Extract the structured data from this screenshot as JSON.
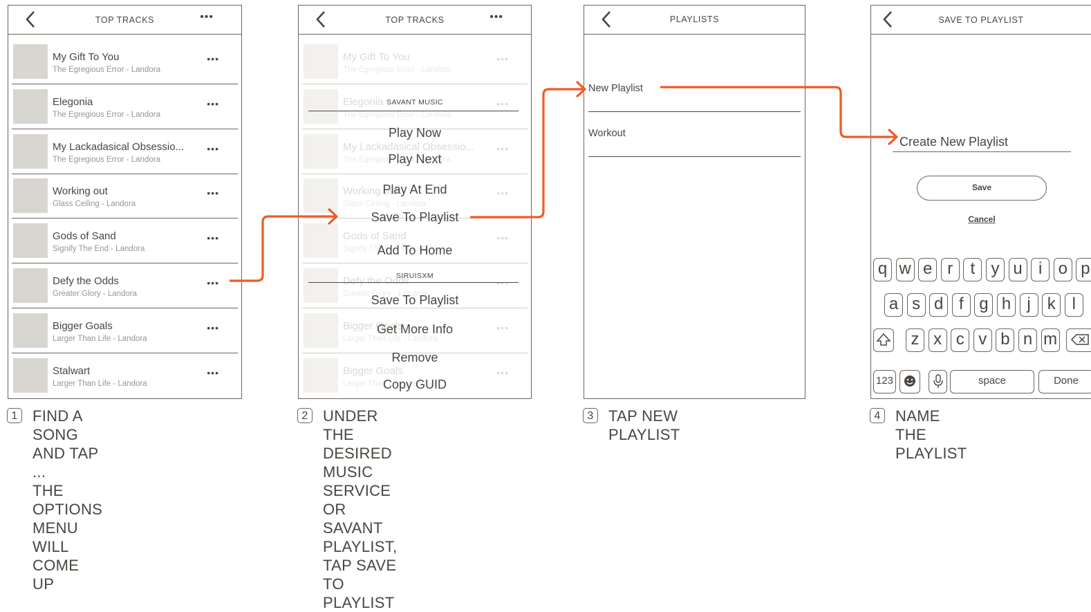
{
  "colors": {
    "accent": "#ee5a24",
    "line": "#6b6560",
    "text": "#4a4540",
    "muted": "#9a958e",
    "thumb": "#d8d6d1"
  },
  "screen1": {
    "title": "TOP TRACKS",
    "more": "•••",
    "tracks": [
      {
        "title": "My Gift To You",
        "subtitle": "The Egregious Error - Landora"
      },
      {
        "title": "Elegonia",
        "subtitle": "The Egregious Error - Landora"
      },
      {
        "title": "My Lackadasical Obsessio...",
        "subtitle": "The Egregious Error - Landora"
      },
      {
        "title": "Working out",
        "subtitle": "Glass Ceiling - Landora"
      },
      {
        "title": "Gods of Sand",
        "subtitle": "Signify The End - Landora"
      },
      {
        "title": "Defy the Odds",
        "subtitle": "Greater Glory - Landora"
      },
      {
        "title": "Bigger Goals",
        "subtitle": "Larger Than Life - Landora"
      },
      {
        "title": "Stalwart",
        "subtitle": "Larger Than Life - Landora"
      }
    ]
  },
  "screen2": {
    "title": "TOP TRACKS",
    "more": "•••",
    "tracks": [
      {
        "title": "My Gift To You",
        "subtitle": "The Egregious Error - Landora"
      },
      {
        "title": "Elegonia",
        "subtitle": "The Egregious Error - Landora"
      },
      {
        "title": "My Lackadasical Obsessio...",
        "subtitle": "The Egregious Error - Landora"
      },
      {
        "title": "Working out",
        "subtitle": "Glass Ceiling - Landora"
      },
      {
        "title": "Gods of Sand",
        "subtitle": "Signify The End - Landora"
      },
      {
        "title": "Defy the Odds",
        "subtitle": "Greater Glory - Landora"
      },
      {
        "title": "Bigger Goals",
        "subtitle": "Larger Than Life - Landora"
      },
      {
        "title": "Bigger Goals",
        "subtitle": "Larger Than Life - Landora"
      }
    ],
    "menu": {
      "savant_header": "SAVANT MUSIC",
      "savant_items": [
        "Play Now",
        "Play Next",
        "Play At End",
        "Save To Playlist",
        "Add To Home"
      ],
      "sirius_header": "SIRUISXM",
      "sirius_items": [
        "Save To Playlist",
        "Get More Info",
        "Remove",
        "Copy GUID"
      ]
    }
  },
  "screen3": {
    "title": "PLAYLISTS",
    "items": [
      "New Playlist",
      "Workout"
    ]
  },
  "screen4": {
    "title": "SAVE TO PLAYLIST",
    "input_value": "Create New Playlist",
    "save_label": "Save",
    "cancel_label": "Cancel",
    "keyboard": {
      "row1": [
        "q",
        "w",
        "e",
        "r",
        "t",
        "y",
        "u",
        "i",
        "o",
        "p"
      ],
      "row2": [
        "a",
        "s",
        "d",
        "f",
        "g",
        "h",
        "j",
        "k",
        "l"
      ],
      "row3": [
        "z",
        "x",
        "c",
        "v",
        "b",
        "n",
        "m"
      ],
      "numbers_key": "123",
      "space_key": "space",
      "done_key": "Done"
    }
  },
  "steps": [
    {
      "num": "1",
      "text": "FIND A SONG AND TAP ...\nTHE OPTIONS MENU\nWILL COME UP"
    },
    {
      "num": "2",
      "text": "UNDER THE DESIRED\nMUSIC SERVICE OR\nSAVANT PLAYLIST,\nTAP SAVE TO PLAYLIST"
    },
    {
      "num": "3",
      "text": "TAP NEW PLAYLIST"
    },
    {
      "num": "4",
      "text": "NAME THE PLAYLIST"
    }
  ]
}
